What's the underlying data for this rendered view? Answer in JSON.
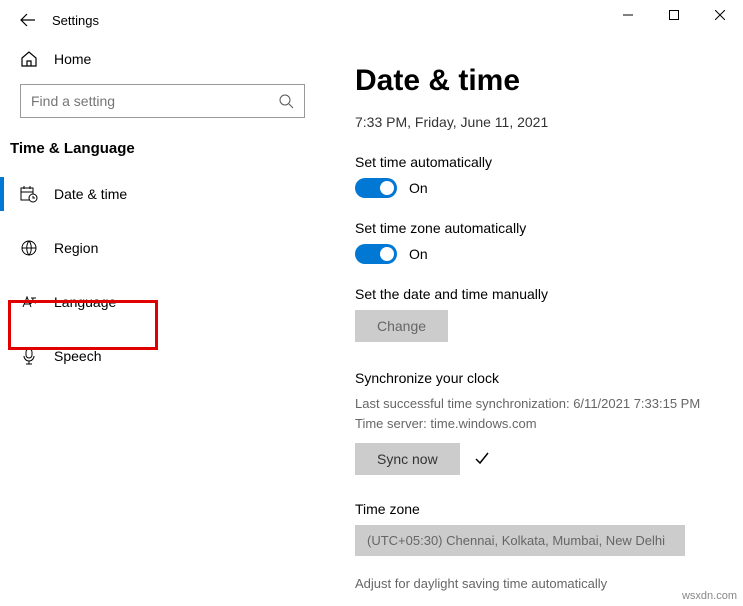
{
  "titlebar": {
    "title": "Settings"
  },
  "sidebar": {
    "home": "Home",
    "search_placeholder": "Find a setting",
    "category": "Time & Language",
    "items": [
      {
        "label": "Date & time"
      },
      {
        "label": "Region"
      },
      {
        "label": "Language"
      },
      {
        "label": "Speech"
      }
    ]
  },
  "main": {
    "heading": "Date & time",
    "current": "7:33 PM, Friday, June 11, 2021",
    "auto_time_label": "Set time automatically",
    "auto_time_state": "On",
    "auto_tz_label": "Set time zone automatically",
    "auto_tz_state": "On",
    "manual_label": "Set the date and time manually",
    "change_btn": "Change",
    "sync_heading": "Synchronize your clock",
    "sync_last": "Last successful time synchronization: 6/11/2021 7:33:15 PM",
    "sync_server": "Time server: time.windows.com",
    "sync_btn": "Sync now",
    "tz_heading": "Time zone",
    "tz_value": "(UTC+05:30) Chennai, Kolkata, Mumbai, New Delhi",
    "dst_note": "Adjust for daylight saving time automatically"
  },
  "watermark": "wsxdn.com"
}
